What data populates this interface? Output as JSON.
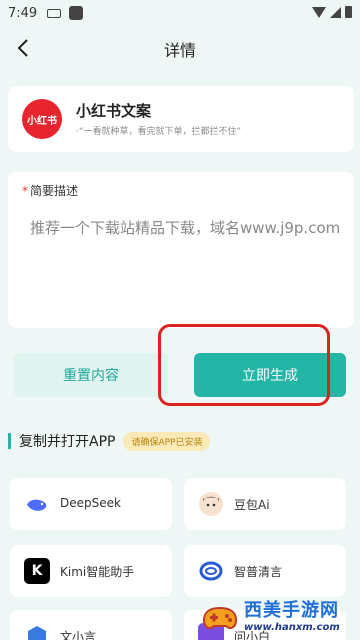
{
  "status_bar": {
    "time": "7:49"
  },
  "nav": {
    "title": "详情"
  },
  "app": {
    "logo_text": "小红书",
    "name": "小红书文案",
    "description": "·“一看就种草，看完就下单，拦都拦不住”"
  },
  "form": {
    "label": "简要描述",
    "required_mark": "*",
    "value": "推荐一个下载站精品下载，域名www.j9p.com"
  },
  "buttons": {
    "reset": "重置内容",
    "generate": "立即生成"
  },
  "section": {
    "title": "复制并打开APP",
    "badge": "请确保APP已安装"
  },
  "apps": [
    {
      "label": "DeepSeek",
      "icon": "deepseek-whale-icon",
      "color": "#4d6bfe"
    },
    {
      "label": "豆包Ai",
      "icon": "doubao-avatar-icon",
      "color": "#f3c7a5"
    },
    {
      "label": "Kimi智能助手",
      "icon": "kimi-k-icon",
      "color": "#000000"
    },
    {
      "label": "智普清言",
      "icon": "zhipu-ring-icon",
      "color": "#2a5bd7"
    },
    {
      "label": "文小言",
      "icon": "wenxiaoyan-icon",
      "color": "#3a7ae0"
    },
    {
      "label": "问小白",
      "icon": "wenxiaobai-icon",
      "color": "#7a4de0"
    }
  ],
  "watermark": {
    "title": "西美手游网",
    "url": "www.hanxm.com"
  },
  "colors": {
    "accent": "#23b5a6",
    "accent_light": "#dff3ef",
    "background": "#eef7f5",
    "highlight": "#d22222"
  }
}
